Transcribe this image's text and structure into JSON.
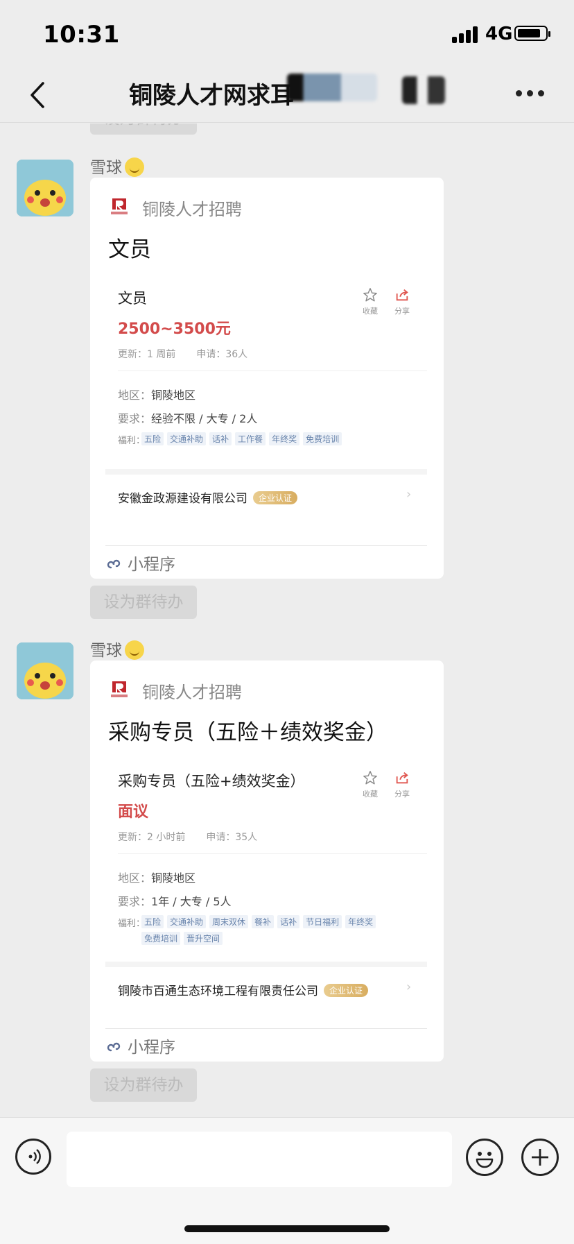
{
  "status": {
    "time": "10:31",
    "network": "4G"
  },
  "nav": {
    "title": "铜陵人才网求耳"
  },
  "messages": [
    {
      "sender": "雪球",
      "card": {
        "source": "铜陵人才招聘",
        "title": "文员",
        "job_title": "文员",
        "salary": "2500~3500元",
        "updated": "更新：1 周前",
        "applied": "申请：36人",
        "region_label": "地区：",
        "region": "铜陵地区",
        "req_label": "要求：",
        "requirements": "经验不限 / 大专 / 2人",
        "welfare_label": "福利：",
        "welfare": [
          "五险",
          "交通补助",
          "话补",
          "工作餐",
          "年终奖",
          "免费培训"
        ],
        "company": "安徽金政源建设有限公司",
        "badge": "企业认证",
        "actions": {
          "fav": "收藏",
          "share": "分享"
        },
        "footer": "小程序"
      },
      "todo": "设为群待办"
    },
    {
      "sender": "雪球",
      "card": {
        "source": "铜陵人才招聘",
        "title": "采购专员（五险＋绩效奖金）",
        "job_title": "采购专员（五险+绩效奖金）",
        "salary": "面议",
        "updated": "更新：2 小时前",
        "applied": "申请：35人",
        "region_label": "地区：",
        "region": "铜陵地区",
        "req_label": "要求：",
        "requirements": "1年 / 大专 / 5人",
        "welfare_label": "福利：",
        "welfare": [
          "五险",
          "交通补助",
          "周末双休",
          "餐补",
          "话补",
          "节日福利",
          "年终奖",
          "免费培训",
          "晋升空间"
        ],
        "company": "铜陵市百通生态环境工程有限责任公司",
        "badge": "企业认证",
        "actions": {
          "fav": "收藏",
          "share": "分享"
        },
        "footer": "小程序"
      },
      "todo": "设为群待办"
    }
  ],
  "top_todo": "设为群待办",
  "icons": [
    "back-icon",
    "more-icon",
    "voice-icon",
    "emoji-icon",
    "plus-icon",
    "star-icon",
    "share-icon",
    "miniprogram-icon"
  ],
  "colors": {
    "salary": "#d34b4b",
    "tag_text": "#6783ab",
    "badge": "#d8ad60"
  }
}
